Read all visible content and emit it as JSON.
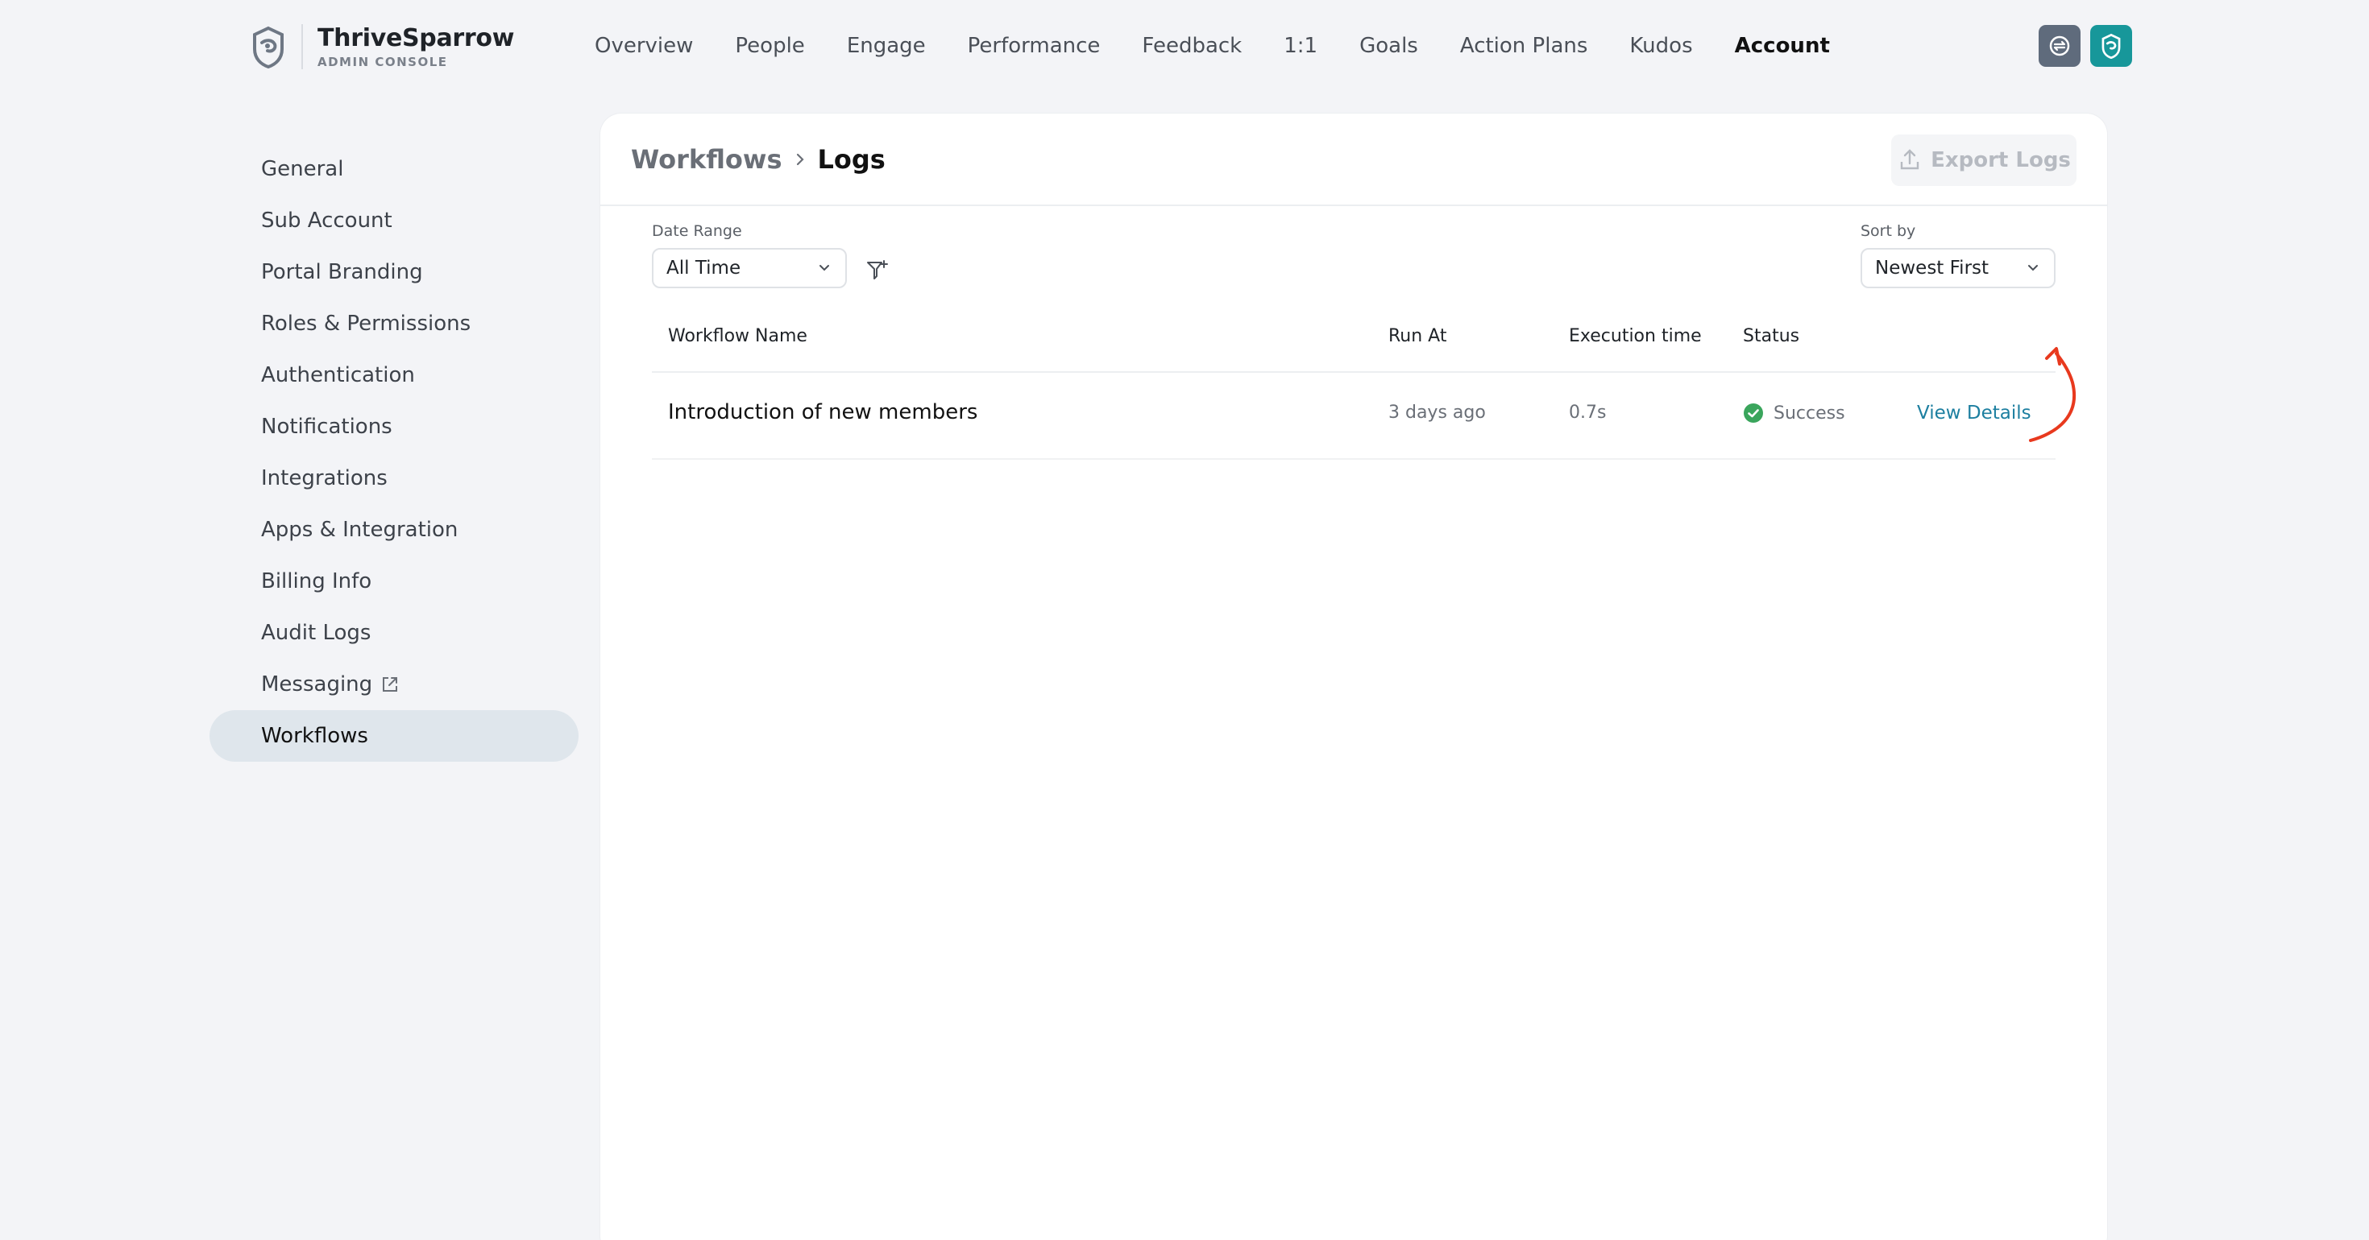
{
  "brand": {
    "name": "ThriveSparrow",
    "subtitle": "ADMIN CONSOLE"
  },
  "nav": {
    "items": [
      {
        "label": "Overview"
      },
      {
        "label": "People"
      },
      {
        "label": "Engage"
      },
      {
        "label": "Performance"
      },
      {
        "label": "Feedback"
      },
      {
        "label": "1:1"
      },
      {
        "label": "Goals"
      },
      {
        "label": "Action Plans"
      },
      {
        "label": "Kudos"
      },
      {
        "label": "Account"
      }
    ],
    "active": "Account"
  },
  "sidebar": {
    "items": [
      {
        "label": "General"
      },
      {
        "label": "Sub Account"
      },
      {
        "label": "Portal Branding"
      },
      {
        "label": "Roles & Permissions"
      },
      {
        "label": "Authentication"
      },
      {
        "label": "Notifications"
      },
      {
        "label": "Integrations"
      },
      {
        "label": "Apps & Integration"
      },
      {
        "label": "Billing Info"
      },
      {
        "label": "Audit Logs"
      },
      {
        "label": "Messaging"
      },
      {
        "label": "Workflows"
      }
    ],
    "active": "Workflows"
  },
  "breadcrumb": {
    "root": "Workflows",
    "current": "Logs"
  },
  "export_button": "Export Logs",
  "filters": {
    "date_range_label": "Date Range",
    "date_range_value": "All Time",
    "sort_label": "Sort by",
    "sort_value": "Newest First"
  },
  "table": {
    "headers": [
      "Workflow Name",
      "Run At",
      "Execution time",
      "Status"
    ],
    "rows": [
      {
        "name": "Introduction of new members",
        "run_at": "3 days ago",
        "execution_time": "0.7s",
        "status": "Success",
        "action": "View Details"
      }
    ]
  },
  "colors": {
    "accent_teal": "#17979a",
    "link": "#1d7fa0",
    "success": "#3aa55c",
    "annotation_arrow": "#e8391e"
  }
}
